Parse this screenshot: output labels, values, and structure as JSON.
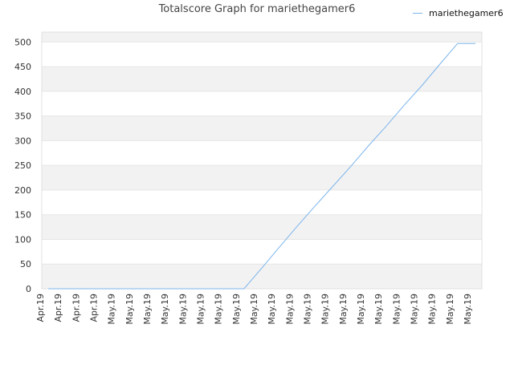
{
  "chart_data": {
    "type": "line",
    "title": "Totalscore Graph for mariethegamer6",
    "xlabel": "",
    "ylabel": "",
    "ylim": [
      0,
      520
    ],
    "yticks": [
      0,
      50,
      100,
      150,
      200,
      250,
      300,
      350,
      400,
      450,
      500
    ],
    "categories": [
      "Apr.19",
      "Apr.19",
      "Apr.19",
      "Apr.19",
      "May.19",
      "May.19",
      "May.19",
      "May.19",
      "May.19",
      "May.19",
      "May.19",
      "May.19",
      "May.19",
      "May.19",
      "May.19",
      "May.19",
      "May.19",
      "May.19",
      "May.19",
      "May.19",
      "May.19",
      "May.19",
      "May.19",
      "May.19",
      "May.19"
    ],
    "series": [
      {
        "name": "mariethegamer6",
        "values": [
          0,
          0,
          0,
          0,
          0,
          0,
          0,
          0,
          0,
          0,
          0,
          0,
          42,
          85,
          127,
          168,
          208,
          248,
          290,
          330,
          372,
          412,
          455,
          497,
          497
        ],
        "color": "#7cb5ec"
      }
    ],
    "grid": true,
    "band_color": "#f2f2f2",
    "legend_position": "top-right"
  }
}
